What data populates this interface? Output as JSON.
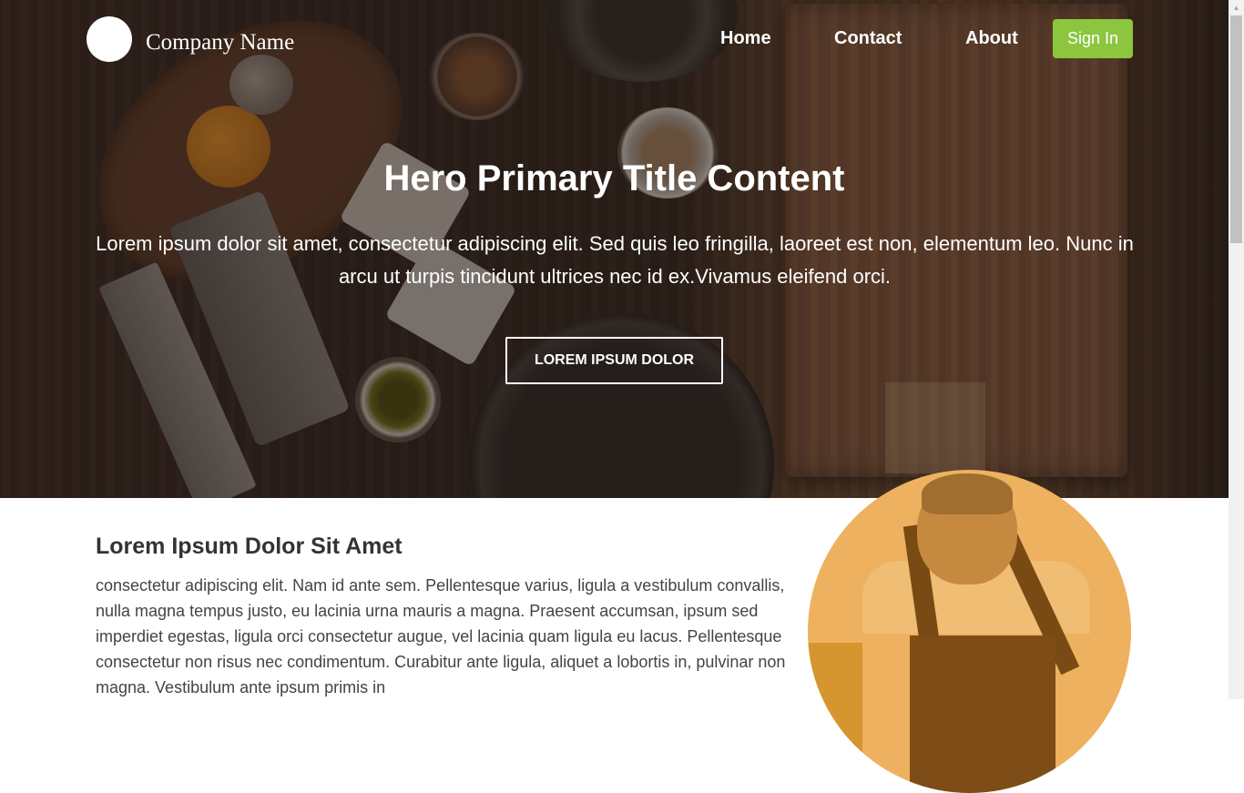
{
  "header": {
    "company_name": "Company Name",
    "nav": [
      {
        "label": "Home"
      },
      {
        "label": "Contact"
      },
      {
        "label": "About"
      }
    ],
    "sign_in_label": "Sign In",
    "sign_in_color": "#8cc63f"
  },
  "hero": {
    "title": "Hero Primary Title Content",
    "text": "Lorem ipsum dolor sit amet, consectetur adipiscing elit. Sed quis leo fringilla, laoreet est non, elementum leo. Nunc in arcu ut turpis tincidunt ultrices nec id ex.Vivamus eleifend orci.",
    "button_label": "LOREM IPSUM DOLOR"
  },
  "section": {
    "title": "Lorem Ipsum Dolor Sit Amet",
    "text": "consectetur adipiscing elit. Nam id ante sem. Pellentesque varius, ligula a vestibulum convallis, nulla magna tempus justo, eu lacinia urna mauris a magna. Praesent accumsan, ipsum sed imperdiet egestas, ligula orci consectetur augue, vel lacinia quam ligula eu lacus. Pellentesque consectetur non risus nec condimentum. Curabitur ante ligula, aliquet a lobortis in, pulvinar non magna. Vestibulum ante ipsum primis in",
    "image_tint": "#eeb15f"
  },
  "icons": {
    "logo": "logo-circle-icon",
    "scroll_up": "chevron-up-icon"
  }
}
